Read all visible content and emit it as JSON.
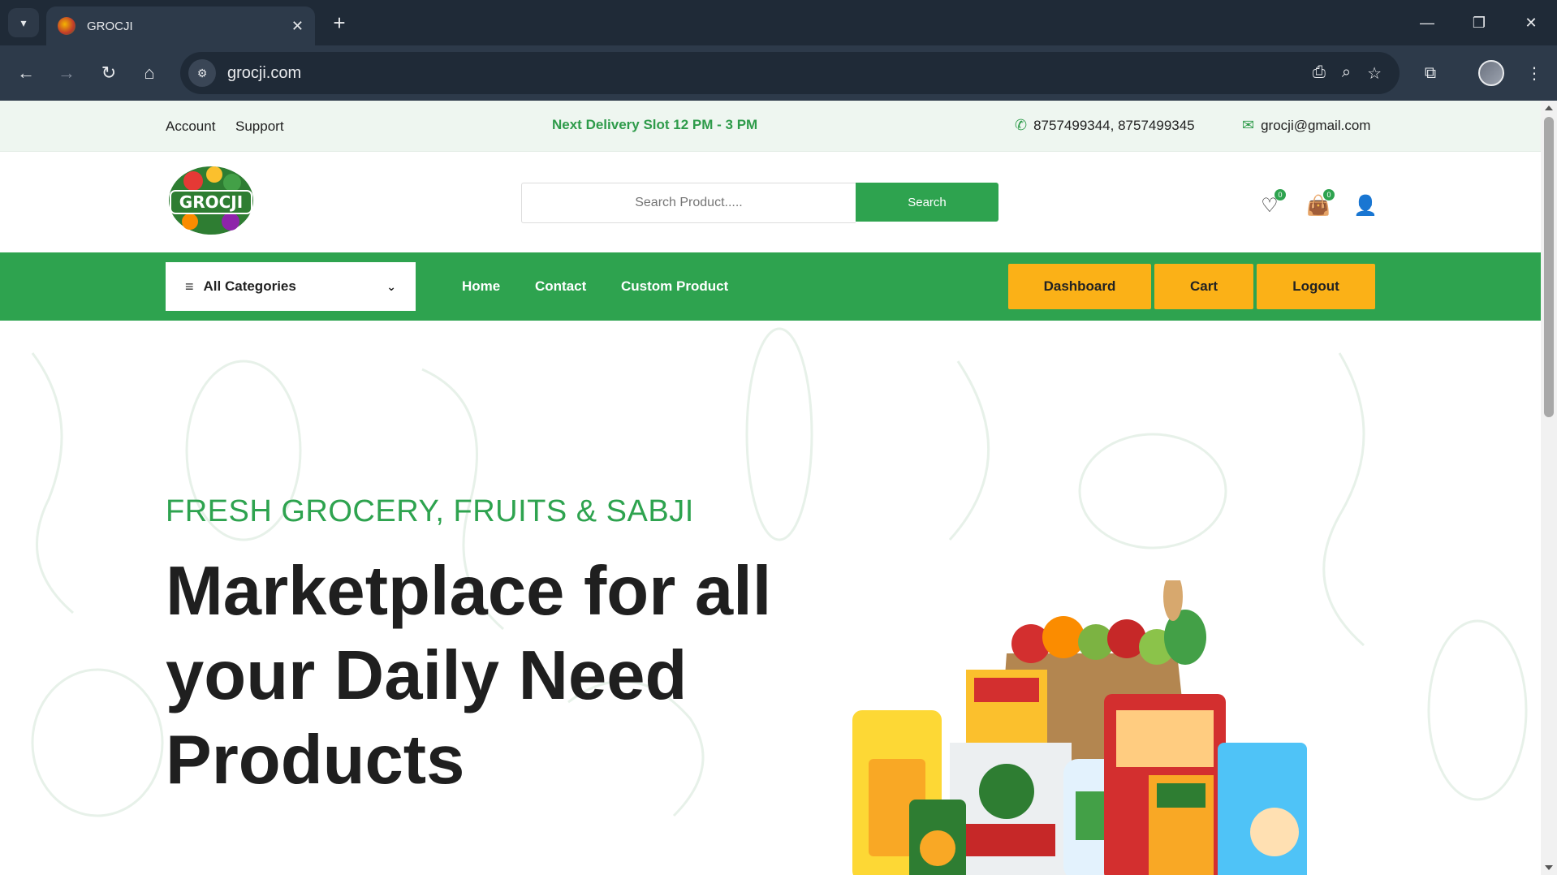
{
  "browser": {
    "tab_title": "GROCJI",
    "url": "grocji.com"
  },
  "topbar": {
    "account": "Account",
    "support": "Support",
    "delivery_slot": "Next Delivery Slot 12 PM - 3 PM",
    "phones": "8757499344, 8757499345",
    "email": "grocji@gmail.com"
  },
  "header": {
    "logo_text": "GROCJI",
    "search_placeholder": "Search Product.....",
    "search_button": "Search",
    "wishlist_count": "0",
    "cart_count": "0"
  },
  "nav": {
    "categories": "All Categories",
    "links": [
      "Home",
      "Contact",
      "Custom Product"
    ],
    "buttons": [
      "Dashboard",
      "Cart",
      "Logout"
    ]
  },
  "hero": {
    "kicker": "FRESH GROCERY, FRUITS & SABJI",
    "headline": "Marketplace for all your Daily Need Products"
  },
  "colors": {
    "brand_green": "#2ea34f",
    "accent_yellow": "#fbb117"
  }
}
